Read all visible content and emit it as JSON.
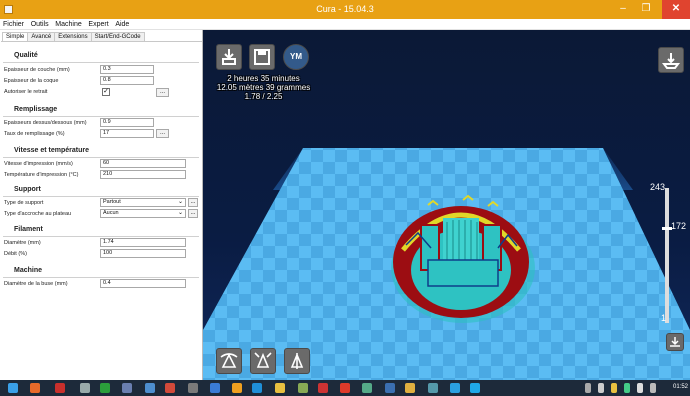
{
  "window": {
    "title": "Cura - 15.04.3",
    "minimize_glyph": "–",
    "maximize_glyph": "❐",
    "close_glyph": "✕"
  },
  "menu": [
    "Fichier",
    "Outils",
    "Machine",
    "Expert",
    "Aide"
  ],
  "tabs": [
    "Simple",
    "Avancé",
    "Extensions",
    "Start/End-GCode"
  ],
  "sections": {
    "qualite": "Qualité",
    "remplissage": "Remplissage",
    "vitesse": "Vitesse et température",
    "support": "Support",
    "filament": "Filament",
    "machine": "Machine"
  },
  "fields": {
    "epaisseur_couche": {
      "label": "Epaisseur de couche (mm)",
      "value": "0.3"
    },
    "epaisseur_coque": {
      "label": "Epaisseur de la coque",
      "value": "0.8"
    },
    "retrait": {
      "label": "Autoriser le retrait",
      "checked": "✓"
    },
    "epaisseur_dessus": {
      "label": "Epaisseurs dessus/dessous (mm)",
      "value": "0.9"
    },
    "taux_remplissage": {
      "label": "Taux de remplissage (%)",
      "value": "17"
    },
    "vitesse_impression": {
      "label": "Vitesse d'impression (mm/s)",
      "value": "60"
    },
    "temperature": {
      "label": "Température d'impression (°C)",
      "value": "210"
    },
    "type_support": {
      "label": "Type de support",
      "value": "Partout"
    },
    "accroche": {
      "label": "Type d'accroche au plateau",
      "value": "Aucun"
    },
    "diametre": {
      "label": "Diamètre (mm)",
      "value": "1.74"
    },
    "debit": {
      "label": "Débit (%)",
      "value": "100"
    },
    "buse": {
      "label": "Diamètre de la buse (mm)",
      "value": "0.4"
    }
  },
  "more_button_label": "...",
  "viewport": {
    "stats": [
      "2 heures 35 minutes",
      "12.05 mètres 39 grammes",
      "1.78 / 2.25"
    ],
    "badge_label": "YM",
    "layer_slider": {
      "max_label": "243",
      "current_label": "172",
      "min_label": "1",
      "max": 243,
      "current": 172
    }
  },
  "colors": {
    "titlebar": "#e8a114",
    "close": "#e0442f",
    "floor": "#4fb6ee",
    "part_red": "#9c0d12",
    "part_cyan": "#2ec2c2",
    "part_yellow": "#e1d829"
  },
  "taskbar": {
    "time": "01:52"
  }
}
